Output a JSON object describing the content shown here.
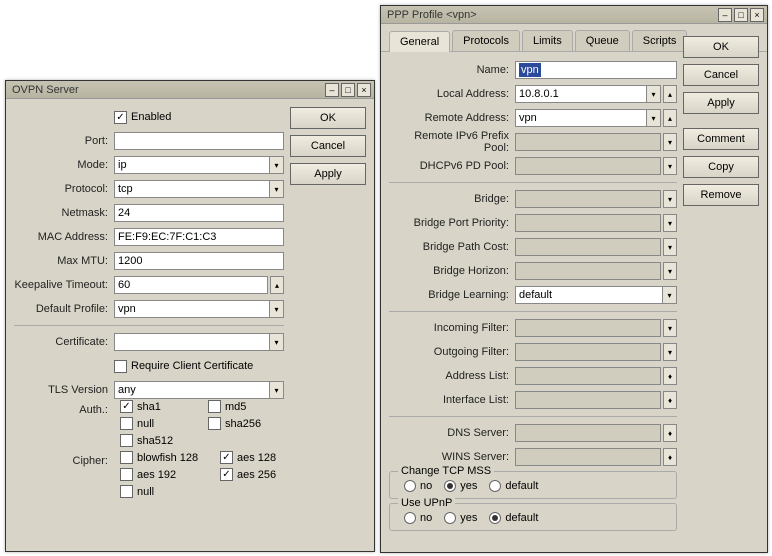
{
  "ovpn": {
    "title": "OVPN Server",
    "buttons": {
      "ok": "OK",
      "cancel": "Cancel",
      "apply": "Apply"
    },
    "enabled": "Enabled",
    "port": {
      "label": "Port:",
      "value": ""
    },
    "mode": {
      "label": "Mode:",
      "value": "ip"
    },
    "protocol": {
      "label": "Protocol:",
      "value": "tcp"
    },
    "netmask": {
      "label": "Netmask:",
      "value": "24"
    },
    "mac": {
      "label": "MAC Address:",
      "value": "FE:F9:EC:7F:C1:C3"
    },
    "mtu": {
      "label": "Max MTU:",
      "value": "1200"
    },
    "keepalive": {
      "label": "Keepalive Timeout:",
      "value": "60"
    },
    "profile": {
      "label": "Default Profile:",
      "value": "vpn"
    },
    "cert": {
      "label": "Certificate:",
      "value": ""
    },
    "require_cert": "Require Client Certificate",
    "tls": {
      "label": "TLS Version",
      "value": "any"
    },
    "auth_label": "Auth.:",
    "auth": {
      "sha1": "sha1",
      "md5": "md5",
      "null": "null",
      "sha256": "sha256",
      "sha512": "sha512"
    },
    "cipher_label": "Cipher:",
    "cipher": {
      "blowfish": "blowfish 128",
      "aes128": "aes 128",
      "aes192": "aes 192",
      "aes256": "aes 256",
      "null": "null"
    }
  },
  "ppp": {
    "title": "PPP Profile <vpn>",
    "tabs": {
      "general": "General",
      "protocols": "Protocols",
      "limits": "Limits",
      "queue": "Queue",
      "scripts": "Scripts"
    },
    "buttons": {
      "ok": "OK",
      "cancel": "Cancel",
      "apply": "Apply",
      "comment": "Comment",
      "copy": "Copy",
      "remove": "Remove"
    },
    "name": {
      "label": "Name:",
      "value": "vpn"
    },
    "local": {
      "label": "Local Address:",
      "value": "10.8.0.1"
    },
    "remote": {
      "label": "Remote Address:",
      "value": "vpn"
    },
    "prefix": {
      "label": "Remote IPv6 Prefix Pool:",
      "value": ""
    },
    "dhcp": {
      "label": "DHCPv6 PD Pool:",
      "value": ""
    },
    "bridge": {
      "label": "Bridge:",
      "value": ""
    },
    "bpp": {
      "label": "Bridge Port Priority:",
      "value": ""
    },
    "bpc": {
      "label": "Bridge Path Cost:",
      "value": ""
    },
    "bh": {
      "label": "Bridge Horizon:",
      "value": ""
    },
    "bl": {
      "label": "Bridge Learning:",
      "value": "default"
    },
    "ifilter": {
      "label": "Incoming Filter:",
      "value": ""
    },
    "ofilter": {
      "label": "Outgoing Filter:",
      "value": ""
    },
    "alist": {
      "label": "Address List:",
      "value": ""
    },
    "ilist": {
      "label": "Interface List:",
      "value": ""
    },
    "dns": {
      "label": "DNS Server:",
      "value": ""
    },
    "wins": {
      "label": "WINS Server:",
      "value": ""
    },
    "tcpmss": {
      "legend": "Change TCP MSS",
      "no": "no",
      "yes": "yes",
      "default": "default"
    },
    "upnp": {
      "legend": "Use UPnP",
      "no": "no",
      "yes": "yes",
      "default": "default"
    }
  }
}
